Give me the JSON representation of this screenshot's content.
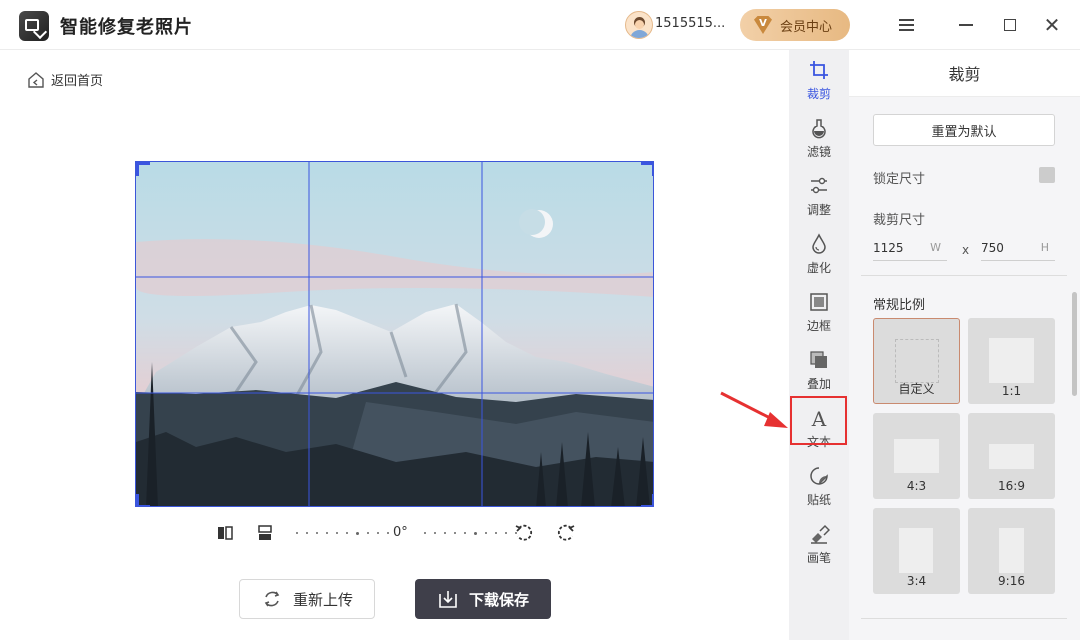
{
  "app": {
    "title": "智能修复老照片",
    "username": "1515515...",
    "vip_label": "会员中心",
    "vip_badge": "V",
    "accent_color": "#3a55e0",
    "highlight_color": "#e63131"
  },
  "editor": {
    "back_label": "返回首页",
    "rotation_angle": "0°",
    "reupload_label": "重新上传",
    "download_label": "下载保存"
  },
  "tools": [
    {
      "label": "裁剪",
      "icon": "crop-icon",
      "active": true
    },
    {
      "label": "滤镜",
      "icon": "filter-flask-icon",
      "active": false
    },
    {
      "label": "调整",
      "icon": "adjust-sliders-icon",
      "active": false
    },
    {
      "label": "虚化",
      "icon": "blur-drop-icon",
      "active": false
    },
    {
      "label": "边框",
      "icon": "frame-icon",
      "active": false
    },
    {
      "label": "叠加",
      "icon": "overlay-icon",
      "active": false
    },
    {
      "label": "文本",
      "icon": "text-icon",
      "active": false
    },
    {
      "label": "贴纸",
      "icon": "sticker-icon",
      "active": false
    },
    {
      "label": "画笔",
      "icon": "brush-icon",
      "active": false
    }
  ],
  "panel": {
    "title": "裁剪",
    "reset_label": "重置为默认",
    "lock_label": "锁定尺寸",
    "lock_checked": false,
    "size_label": "裁剪尺寸",
    "width_value": "1125",
    "width_unit": "W",
    "times": "x",
    "height_value": "750",
    "height_unit": "H",
    "ratio_heading": "常规比例",
    "ratios": [
      {
        "label": "自定义",
        "selected": true
      },
      {
        "label": "1:1",
        "selected": false
      },
      {
        "label": "4:3",
        "selected": false
      },
      {
        "label": "16:9",
        "selected": false
      },
      {
        "label": "3:4",
        "selected": false
      },
      {
        "label": "9:16",
        "selected": false
      }
    ]
  }
}
